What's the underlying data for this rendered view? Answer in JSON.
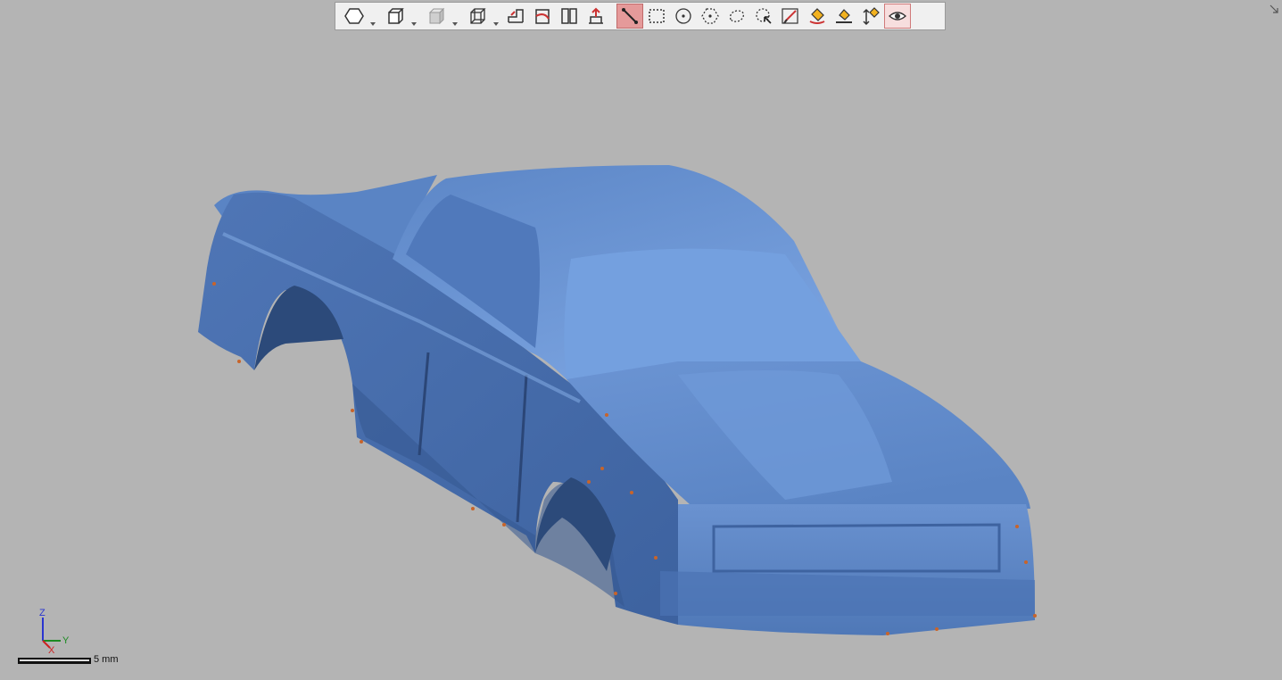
{
  "toolbar": {
    "tools": [
      {
        "name": "select-by-polyhedron",
        "icon": "hexagon-icon",
        "dropdown": true
      },
      {
        "name": "view-cube",
        "icon": "cube-icon",
        "dropdown": true
      },
      {
        "name": "shading-mode",
        "icon": "shaded-cube-icon",
        "dropdown": true
      },
      {
        "name": "bounding-box",
        "icon": "wireframe-cube-icon",
        "dropdown": true
      },
      {
        "name": "section-plane-a",
        "icon": "section-plane-icon"
      },
      {
        "name": "section-plane-b",
        "icon": "section-plane-alt-icon"
      },
      {
        "name": "split-view",
        "icon": "split-view-icon"
      },
      {
        "name": "normal-direction",
        "icon": "normal-arrow-icon"
      },
      {
        "name": "line-select",
        "icon": "line-select-icon",
        "state": "active"
      },
      {
        "name": "rectangle-select",
        "icon": "rectangle-select-icon"
      },
      {
        "name": "circle-select",
        "icon": "circle-select-icon"
      },
      {
        "name": "polygon-select",
        "icon": "polygon-select-icon"
      },
      {
        "name": "freeform-select",
        "icon": "lasso-icon"
      },
      {
        "name": "brush-select",
        "icon": "brush-select-icon"
      },
      {
        "name": "paint-select",
        "icon": "paint-select-icon"
      },
      {
        "name": "fill-select",
        "icon": "bucket-fill-icon"
      },
      {
        "name": "surface-select",
        "icon": "surface-fill-icon"
      },
      {
        "name": "depth-select",
        "icon": "depth-arrow-icon"
      },
      {
        "name": "visible-only",
        "icon": "eye-icon",
        "state": "toggled"
      }
    ]
  },
  "colors": {
    "background": "#b4b4b4",
    "mesh": "#5b86c8",
    "mesh_shadow": "#2f4f82",
    "mesh_highlight": "#8fb3ea",
    "boundary_artifacts": "#c8642a"
  },
  "triad": {
    "z": "Z",
    "y": "Y",
    "x": "X"
  },
  "scale": {
    "label": "5 mm"
  }
}
